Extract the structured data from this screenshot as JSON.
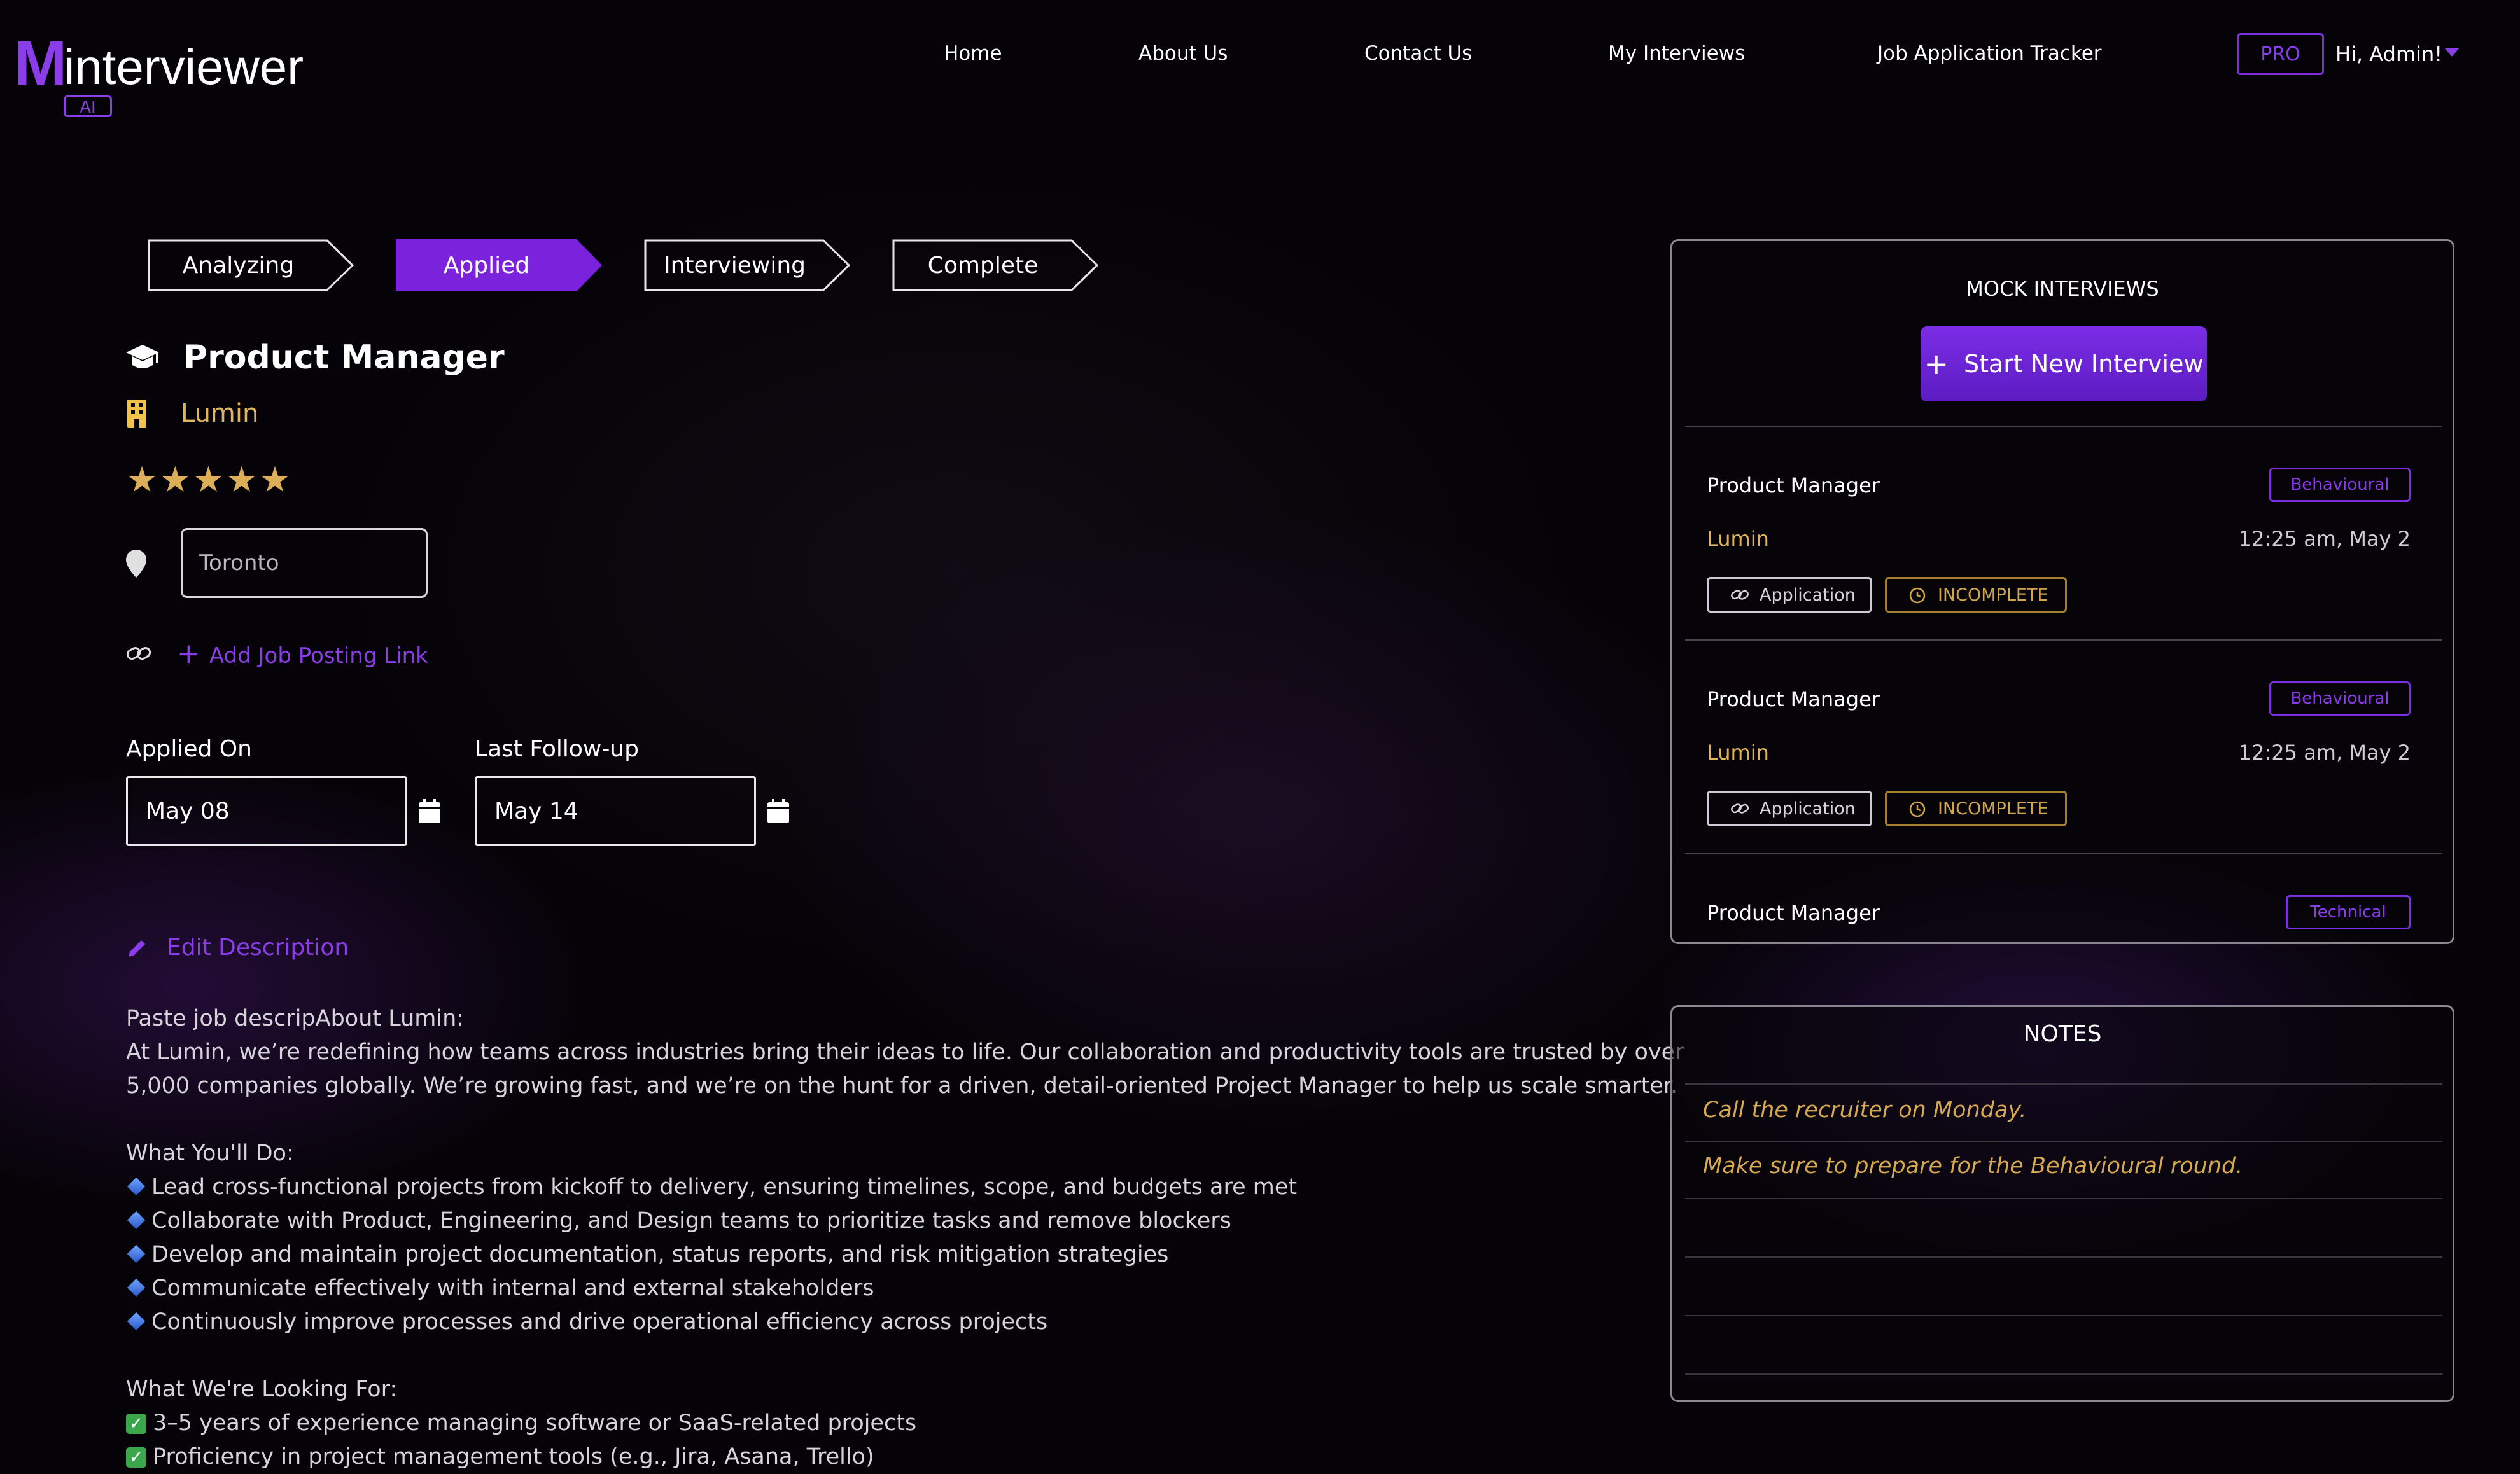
{
  "brand": {
    "initial": "M",
    "word": "interviewer",
    "badge": "AI",
    "accent": "#8b3dea"
  },
  "nav": {
    "items": [
      "Home",
      "About Us",
      "Contact Us",
      "My Interviews",
      "Job Application Tracker"
    ],
    "pro_badge": "PRO",
    "greeting": "Hi, Admin!"
  },
  "steps": [
    {
      "label": "Analyzing",
      "active": false
    },
    {
      "label": "Applied",
      "active": true
    },
    {
      "label": "Interviewing",
      "active": false
    },
    {
      "label": "Complete",
      "active": false
    }
  ],
  "job": {
    "title": "Product Manager",
    "company": "Lumin",
    "rating": 5,
    "stars": "★★★★★",
    "location": "Toronto",
    "add_link_label": "Add Job Posting Link",
    "applied_label": "Applied On",
    "applied_value": "May 08",
    "followup_label": "Last Follow-up",
    "followup_value": "May 14",
    "edit_label": "Edit Description"
  },
  "description": {
    "intro": "Paste job descripAbout Lumin:",
    "para1": "At Lumin, we’re redefining how teams across industries bring their ideas to life. Our collaboration and productivity tools are trusted by over",
    "para2": "5,000 companies globally. We’re growing fast, and we’re on the hunt for a driven, detail-oriented Project Manager to help us scale smarter.",
    "do_heading": "What You'll Do:",
    "do_items": [
      "Lead cross-functional projects from kickoff to delivery, ensuring timelines, scope, and budgets are met",
      "Collaborate with Product, Engineering, and Design teams to prioritize tasks and remove blockers",
      "Develop and maintain project documentation, status reports, and risk mitigation strategies",
      "Communicate effectively with internal and external stakeholders",
      "Continuously improve processes and drive operational efficiency across projects"
    ],
    "look_heading": "What We're Looking For:",
    "look_items": [
      "3–5 years of experience managing software or SaaS-related projects",
      "Proficiency in project management tools (e.g., Jira, Asana, Trello)"
    ]
  },
  "mock_panel": {
    "title": "MOCK INTERVIEWS",
    "start_button": "Start New Interview",
    "interviews": [
      {
        "role": "Product Manager",
        "type": "Behavioural",
        "company": "Lumin",
        "time": "12:25 am, May 2",
        "link_label": "Application",
        "status": "INCOMPLETE"
      },
      {
        "role": "Product Manager",
        "type": "Behavioural",
        "company": "Lumin",
        "time": "12:25 am, May 2",
        "link_label": "Application",
        "status": "INCOMPLETE"
      },
      {
        "role": "Product Manager",
        "type": "Technical"
      }
    ]
  },
  "notes_panel": {
    "title": "NOTES",
    "notes": [
      "Call the recruiter on Monday.",
      "Make sure to prepare for the Behavioural round."
    ]
  },
  "colors": {
    "accent": "#8b3dea",
    "gold": "#e0b45a",
    "background": "#050307"
  }
}
